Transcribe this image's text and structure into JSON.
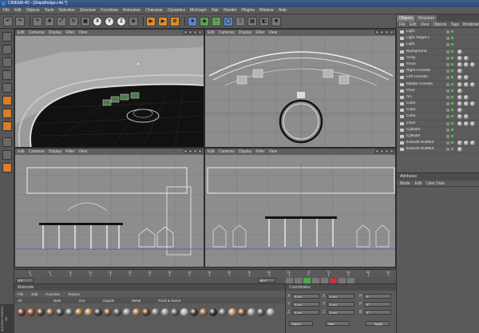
{
  "window": {
    "title": "CINEMA 4D - [ShipsBridge.c4d *]"
  },
  "menu": [
    "File",
    "Edit",
    "Objects",
    "Tools",
    "Selection",
    "Structure",
    "Functions",
    "Animation",
    "Character",
    "Dynamics",
    "MoGraph",
    "Hair",
    "Render",
    "Plugins",
    "Window",
    "Help"
  ],
  "toolbar": {
    "x_label": "X",
    "y_label": "Y",
    "z_label": "Z"
  },
  "viewports": [
    {
      "menu": [
        "Edit",
        "Cameras",
        "Display",
        "Filter",
        "View"
      ],
      "label": "Perspective"
    },
    {
      "menu": [
        "Edit",
        "Cameras",
        "Display",
        "Filter",
        "View"
      ],
      "label": ""
    },
    {
      "menu": [
        "Edit",
        "Cameras",
        "Display",
        "Filter",
        "View"
      ],
      "label": ""
    },
    {
      "menu": [
        "Edit",
        "Cameras",
        "Display",
        "Filter",
        "View"
      ],
      "label": ""
    }
  ],
  "objects_panel": {
    "tabs": [
      "Objects",
      "Structure"
    ],
    "menu": [
      "File",
      "Edit",
      "View",
      "Objects",
      "Tags",
      "Bookmarks"
    ],
    "items": [
      "Light",
      "Light.Target.1",
      "Light",
      "Background",
      "Array",
      "Torus",
      "Right Console",
      "Left Console",
      "Middle Console",
      "Floor",
      "Arc",
      "Cube",
      "Cube",
      "Cube",
      "Chair",
      "Cylinder",
      "Cylinder",
      "Extrude NURBS",
      "Extrude NURBS"
    ]
  },
  "attributes_panel": {
    "tab": "Attributes",
    "menu": [
      "Mode",
      "Edit",
      "User Data"
    ]
  },
  "timeline": {
    "ticks": [
      "0",
      "5",
      "10",
      "15",
      "20",
      "25",
      "30",
      "35",
      "40",
      "45",
      "50",
      "55",
      "60",
      "65",
      "70",
      "75",
      "80",
      "85",
      "90"
    ],
    "frame_start": "0 F",
    "frame_end": "90 F"
  },
  "materials_panel": {
    "tab": "Materials",
    "menu": [
      "File",
      "Edit",
      "Function",
      "Texture"
    ],
    "categories": [
      "All",
      "Bark",
      "Iron",
      "Liquids",
      "Metal",
      "Rock & Stone"
    ]
  },
  "coordinates_panel": {
    "tab": "Coordinates",
    "rows": [
      {
        "axis": "X",
        "value": "0 cm",
        "axis2": "X",
        "value2": "0 cm",
        "axis3": "H",
        "value3": "0°"
      },
      {
        "axis": "Y",
        "value": "0 cm",
        "axis2": "Y",
        "value2": "0 cm",
        "axis3": "P",
        "value3": "0°"
      },
      {
        "axis": "Z",
        "value": "0 cm",
        "axis2": "Z",
        "value2": "0 cm",
        "axis3": "B",
        "value3": "0°"
      }
    ],
    "mode_select": "Object",
    "size_select": "Size",
    "apply_label": "Apply"
  },
  "brand": "MAXON CINEMA 4D"
}
